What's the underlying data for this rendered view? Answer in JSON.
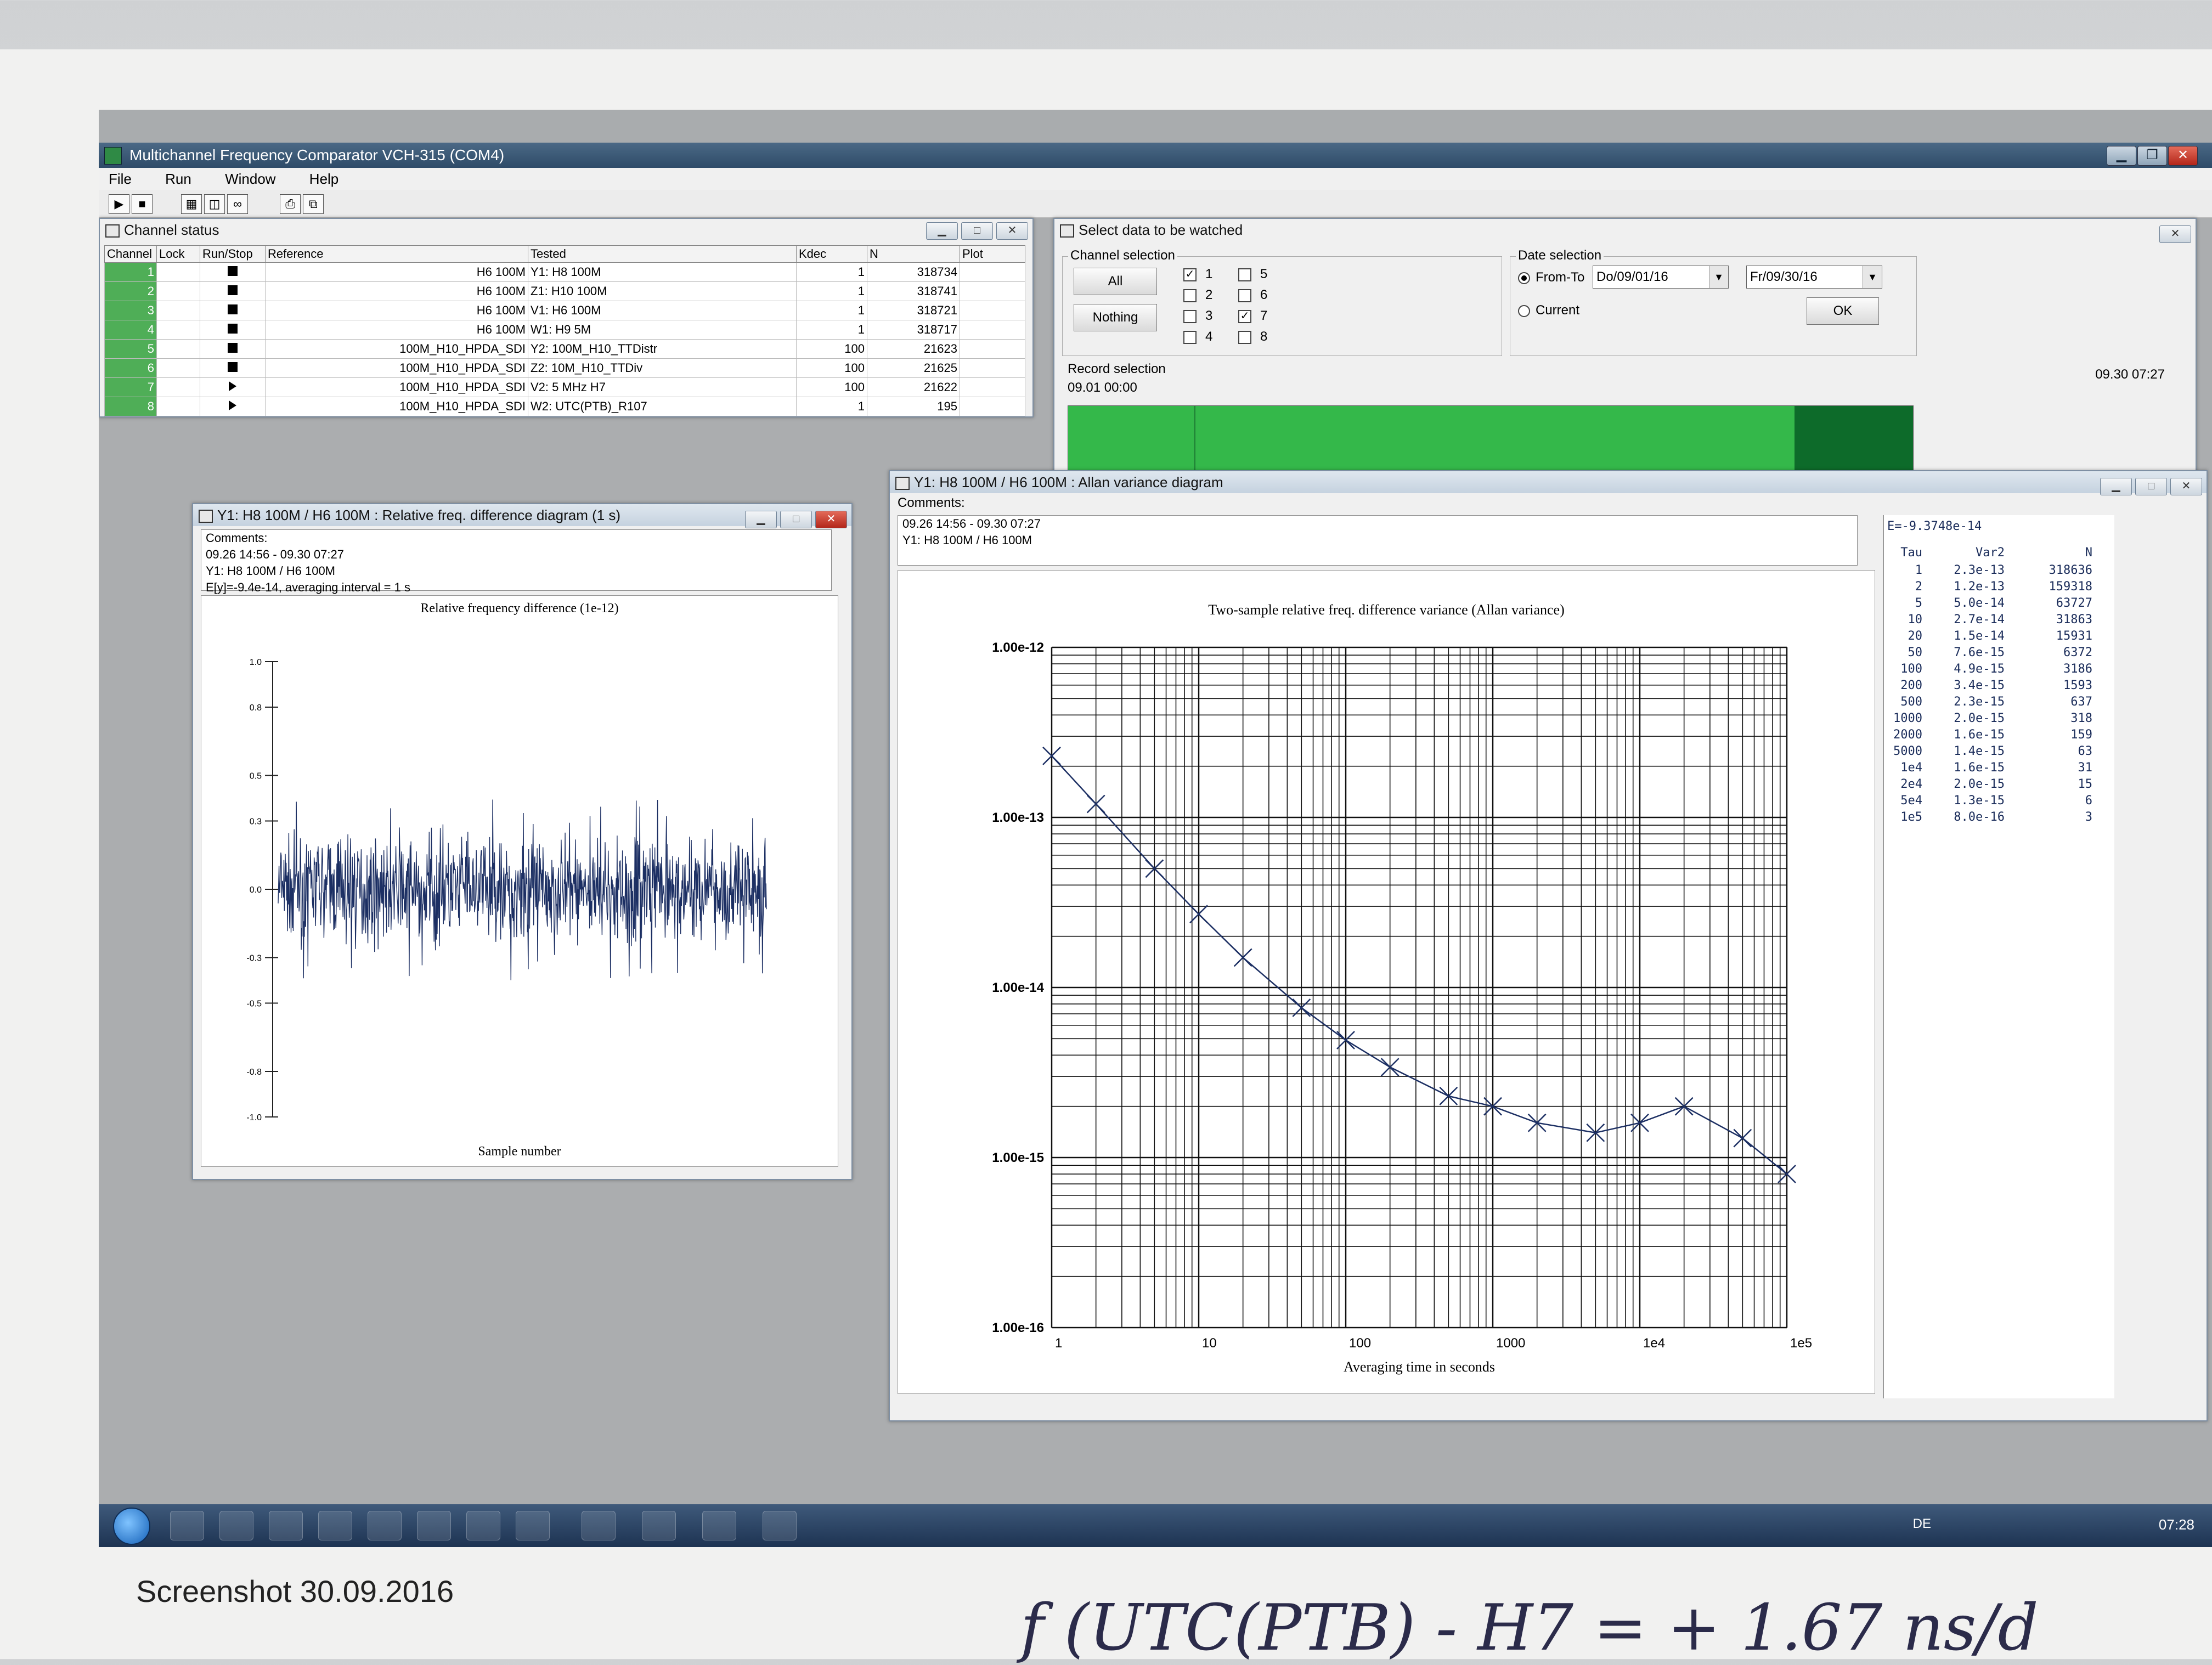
{
  "app": {
    "title": "Multichannel Frequency Comparator VCH-315 (COM4)"
  },
  "menu": [
    "File",
    "Run",
    "Window",
    "Help"
  ],
  "channel_status": {
    "title": "Channel status",
    "columns": [
      "Channel",
      "Lock",
      "Run/Stop",
      "Reference",
      "Tested",
      "Kdec",
      "N",
      "Plot"
    ],
    "rows": [
      {
        "ch": "1",
        "run": "stop",
        "reference": "H6 100M",
        "tested": "Y1: H8 100M",
        "kdec": "1",
        "n": "318734"
      },
      {
        "ch": "2",
        "run": "stop",
        "reference": "H6 100M",
        "tested": "Z1: H10 100M",
        "kdec": "1",
        "n": "318741"
      },
      {
        "ch": "3",
        "run": "stop",
        "reference": "H6 100M",
        "tested": "V1: H6 100M",
        "kdec": "1",
        "n": "318721"
      },
      {
        "ch": "4",
        "run": "stop",
        "reference": "H6 100M",
        "tested": "W1: H9 5M",
        "kdec": "1",
        "n": "318717"
      },
      {
        "ch": "5",
        "run": "stop",
        "reference": "100M_H10_HPDA_SDI",
        "tested": "Y2: 100M_H10_TTDistr",
        "kdec": "100",
        "n": "21623"
      },
      {
        "ch": "6",
        "run": "stop",
        "reference": "100M_H10_HPDA_SDI",
        "tested": "Z2: 10M_H10_TTDiv",
        "kdec": "100",
        "n": "21625"
      },
      {
        "ch": "7",
        "run": "play",
        "reference": "100M_H10_HPDA_SDI",
        "tested": "V2: 5 MHz H7",
        "kdec": "100",
        "n": "21622"
      },
      {
        "ch": "8",
        "run": "play",
        "reference": "100M_H10_HPDA_SDI",
        "tested": "W2: UTC(PTB)_R107",
        "kdec": "1",
        "n": "195"
      }
    ]
  },
  "select_data": {
    "title": "Select data to be watched",
    "channel_selection": "Channel selection",
    "all": "All",
    "nothing": "Nothing",
    "channels": [
      {
        "n": "1",
        "checked": true
      },
      {
        "n": "2",
        "checked": false
      },
      {
        "n": "3",
        "checked": false
      },
      {
        "n": "4",
        "checked": false
      },
      {
        "n": "5",
        "checked": false
      },
      {
        "n": "6",
        "checked": false
      },
      {
        "n": "7",
        "checked": true
      },
      {
        "n": "8",
        "checked": false
      }
    ],
    "date_selection": "Date selection",
    "from_to": "From-To",
    "from": "Do/09/01/16",
    "to": "Fr/09/30/16",
    "current": "Current",
    "ok": "OK",
    "record_selection": "Record selection",
    "record_start": "09.01 00:00",
    "record_end": "09.30 07:27",
    "record_fill": 0.86
  },
  "freq_window": {
    "title": "Y1: H8 100M / H6 100M : Relative freq. difference diagram (1 s)",
    "comments_label": "Comments:",
    "comments": [
      "09.26 14:56 - 09.30 07:27",
      "Y1: H8 100M / H6 100M",
      "E[y]=-9.4e-14,  averaging interval = 1 s"
    ],
    "plot_title": "Relative frequency difference (1e-12)",
    "xlabel": "Sample number",
    "yticks": [
      "1.0",
      "0.8",
      "0.5",
      "0.3",
      "0.0",
      "-0.3",
      "-0.5",
      "-0.8",
      "-1.0"
    ]
  },
  "allan_window": {
    "title": "Y1: H8 100M / H6 100M : Allan variance diagram",
    "comments_label": "Comments:",
    "comments": [
      "09.26 14:56 - 09.30 07:27",
      "Y1: H8 100M / H6 100M"
    ],
    "plot_title": "Two-sample relative freq. difference variance (Allan variance)",
    "xlabel": "Averaging time in seconds",
    "stats_header": "E=-9.3748e-14",
    "stats_cols": [
      "Tau",
      "Var2",
      "N"
    ],
    "stats": [
      [
        "1",
        "2.3e-13",
        "318636"
      ],
      [
        "2",
        "1.2e-13",
        "159318"
      ],
      [
        "5",
        "5.0e-14",
        "63727"
      ],
      [
        "10",
        "2.7e-14",
        "31863"
      ],
      [
        "20",
        "1.5e-14",
        "15931"
      ],
      [
        "50",
        "7.6e-15",
        "6372"
      ],
      [
        "100",
        "4.9e-15",
        "3186"
      ],
      [
        "200",
        "3.4e-15",
        "1593"
      ],
      [
        "500",
        "2.3e-15",
        "637"
      ],
      [
        "1000",
        "2.0e-15",
        "318"
      ],
      [
        "2000",
        "1.6e-15",
        "159"
      ],
      [
        "5000",
        "1.4e-15",
        "63"
      ],
      [
        "1e4",
        "1.6e-15",
        "31"
      ],
      [
        "2e4",
        "2.0e-15",
        "15"
      ],
      [
        "5e4",
        "1.3e-15",
        "6"
      ],
      [
        "1e5",
        "8.0e-16",
        "3"
      ]
    ]
  },
  "chart_data": [
    {
      "type": "line",
      "title": "Relative frequency difference (1e-12)",
      "xlabel": "Sample number",
      "ylabel": "",
      "ylim": [
        -1.0,
        1.0
      ],
      "yticks": [
        1.0,
        0.8,
        0.5,
        0.3,
        0.0,
        -0.3,
        -0.5,
        -0.8,
        -1.0
      ],
      "description_series": {
        "mean_amplitude": 0.2,
        "peak_amplitude": 0.4
      }
    },
    {
      "type": "line",
      "title": "Two-sample relative freq. difference variance (Allan variance)",
      "xlabel": "Averaging time in seconds",
      "x_scale": "log",
      "y_scale": "log",
      "xlim": [
        1,
        100000
      ],
      "ylim": [
        1e-16,
        1e-12
      ],
      "xticks": [
        "1",
        "10",
        "100",
        "1000",
        "1e4",
        "1e5"
      ],
      "yticks": [
        "1.00e-12",
        "1.00e-13",
        "1.00e-14",
        "1.00e-15",
        "1.00e-16"
      ],
      "grid": true,
      "x": [
        1,
        2,
        5,
        10,
        20,
        50,
        100,
        200,
        500,
        1000,
        2000,
        5000,
        10000,
        20000,
        50000,
        100000
      ],
      "y": [
        2.3e-13,
        1.2e-13,
        5e-14,
        2.7e-14,
        1.5e-14,
        7.6e-15,
        4.9e-15,
        3.4e-15,
        2.3e-15,
        2e-15,
        1.6e-15,
        1.4e-15,
        1.6e-15,
        2e-15,
        1.3e-15,
        8e-16
      ]
    }
  ],
  "taskbar": {
    "lang": "DE",
    "clock": "07:28"
  },
  "caption": "Screenshot 30.09.2016",
  "handwriting": "f (UTC(PTB) - H7 = + 1.67 ns/d"
}
